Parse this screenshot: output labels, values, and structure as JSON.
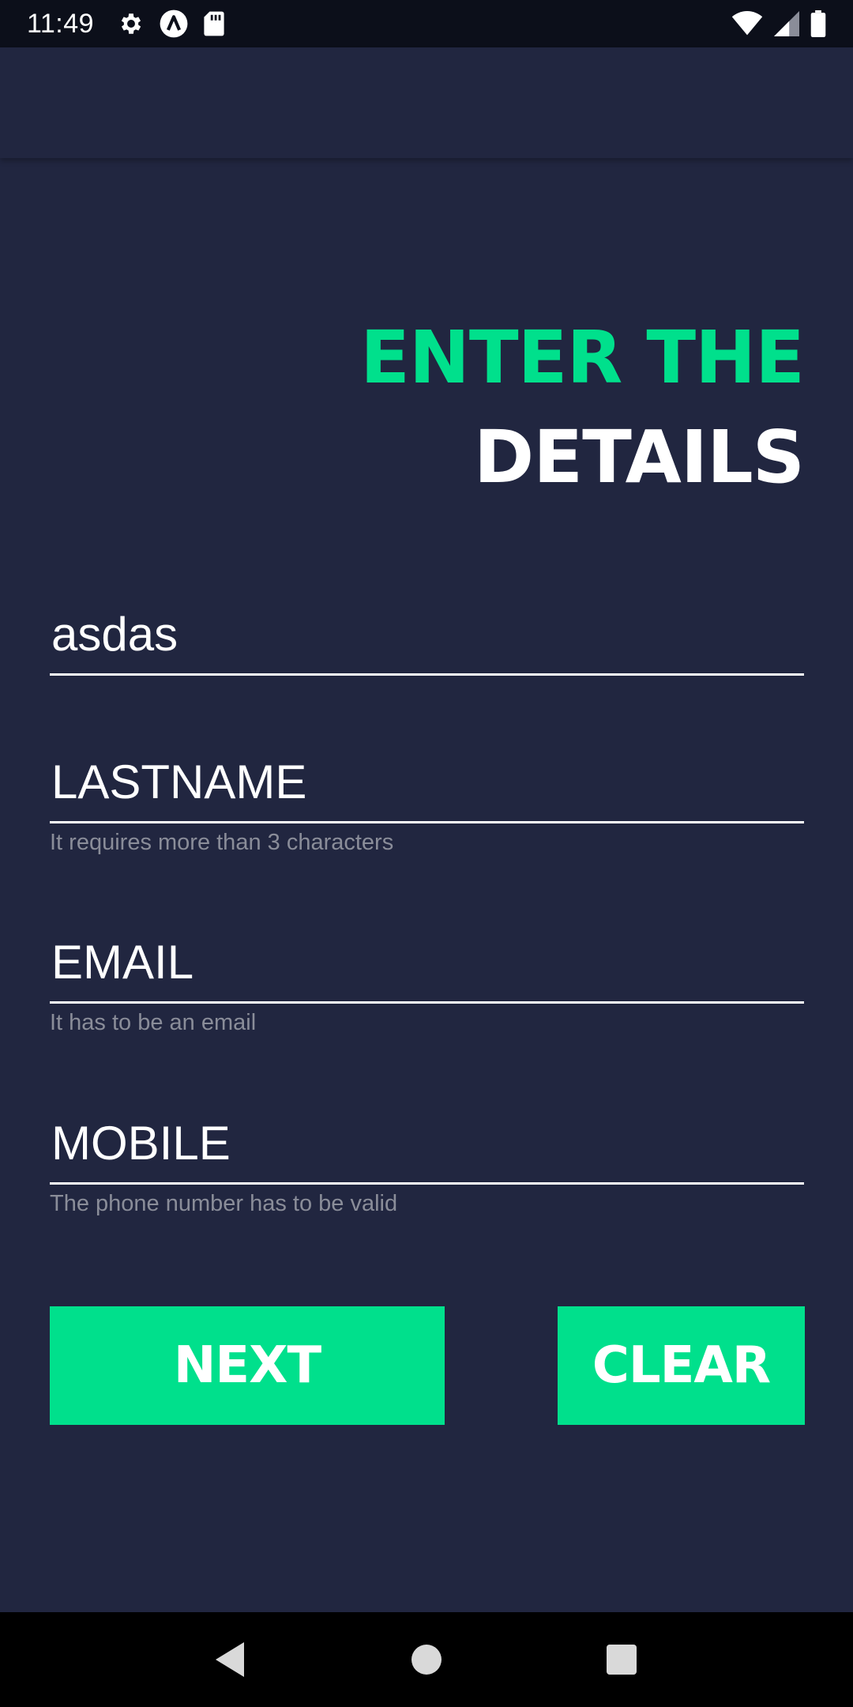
{
  "status_bar": {
    "time": "11:49",
    "left_icons": [
      "settings-icon",
      "app-a-icon",
      "sd-card-icon"
    ],
    "right_icons": [
      "wifi-icon",
      "signal-icon",
      "battery-icon"
    ]
  },
  "heading": {
    "line1": "ENTER THE",
    "line2": "DETAILS",
    "accent_color": "#00e08c"
  },
  "form": {
    "first_name": {
      "value": "asdas",
      "placeholder": "",
      "helper": ""
    },
    "last_name": {
      "value": "",
      "placeholder": "LASTNAME",
      "helper": "It requires more than 3 characters"
    },
    "email": {
      "value": "",
      "placeholder": "EMAIL",
      "helper": "It has to be an email"
    },
    "mobile": {
      "value": "",
      "placeholder": "MOBILE",
      "helper": "The phone number has to be valid"
    }
  },
  "buttons": {
    "next_label": "NEXT",
    "clear_label": "CLEAR",
    "color": "#00e08c"
  },
  "nav_bar": {
    "icons": [
      "back-icon",
      "home-icon",
      "recents-icon"
    ]
  },
  "colors": {
    "background": "#212640",
    "status_bar": "#0c0f1a",
    "helper_text": "#8a8d99"
  }
}
